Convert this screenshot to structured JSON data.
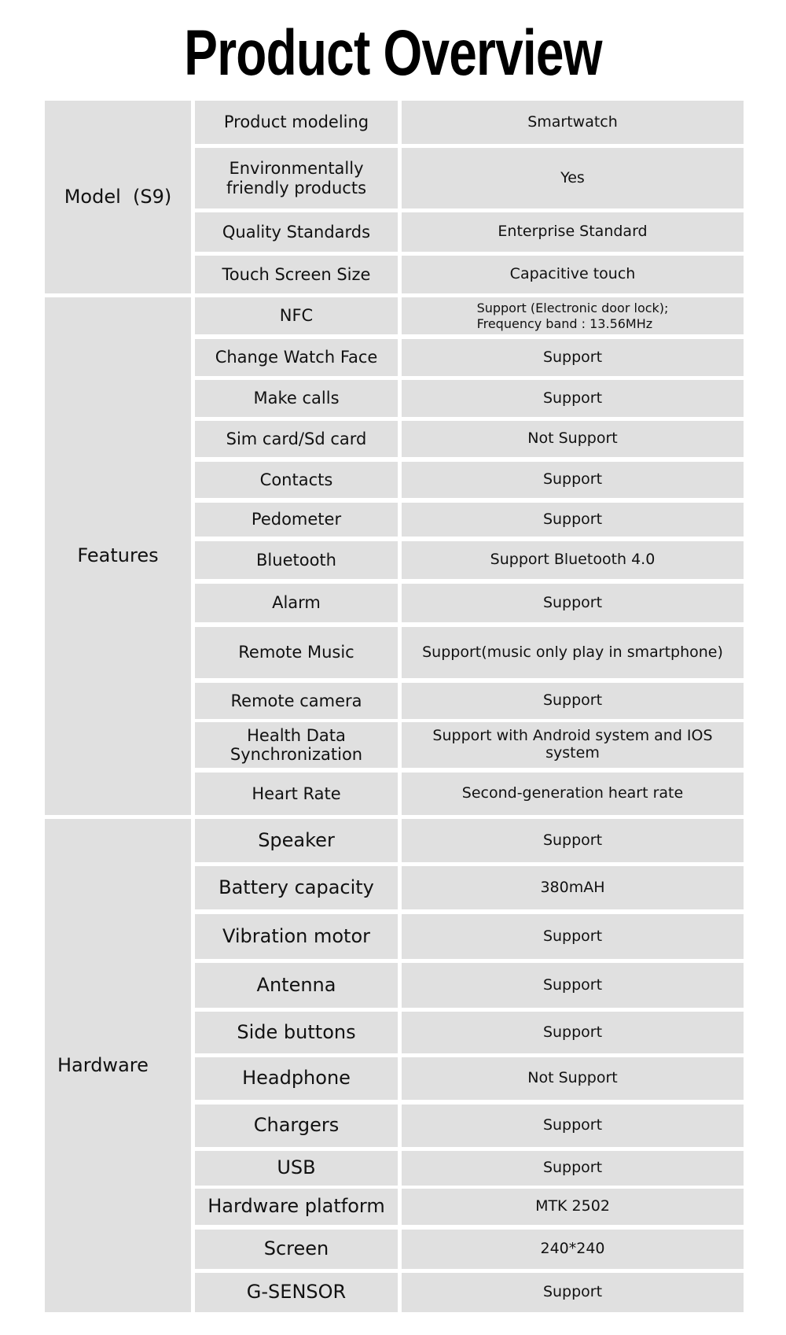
{
  "title": "Product Overview",
  "sections": [
    {
      "group": "Model  (S9)",
      "rows": [
        {
          "label": "Product modeling",
          "value": "Smartwatch"
        },
        {
          "label": "Environmentally friendly products",
          "value": "Yes"
        },
        {
          "label": "Quality Standards",
          "value": "Enterprise Standard"
        },
        {
          "label": "Touch Screen Size",
          "value": "Capacitive touch"
        }
      ]
    },
    {
      "group": "Features",
      "rows": [
        {
          "label": "NFC",
          "value": "Support (Electronic door lock);\nFrequency band : 13.56MHz"
        },
        {
          "label": "Change Watch Face",
          "value": "Support"
        },
        {
          "label": "Make calls",
          "value": "Support"
        },
        {
          "label": "Sim card/Sd card",
          "value": "Not Support"
        },
        {
          "label": "Contacts",
          "value": "Support"
        },
        {
          "label": "Pedometer",
          "value": "Support"
        },
        {
          "label": "Bluetooth",
          "value": "Support Bluetooth 4.0"
        },
        {
          "label": "Alarm",
          "value": "Support"
        },
        {
          "label": "Remote Music",
          "value": "Support(music only play in smartphone)"
        },
        {
          "label": "Remote camera",
          "value": "Support"
        },
        {
          "label": "Health Data Synchronization",
          "value": "Support with Android system and IOS system"
        },
        {
          "label": "Heart Rate",
          "value": "Second-generation heart rate"
        }
      ]
    },
    {
      "group": "Hardware",
      "rows": [
        {
          "label": "Speaker",
          "value": "Support"
        },
        {
          "label": "Battery capacity",
          "value": "380mAH"
        },
        {
          "label": "Vibration motor",
          "value": "Support"
        },
        {
          "label": "Antenna",
          "value": "Support"
        },
        {
          "label": "Side buttons",
          "value": "Support"
        },
        {
          "label": "Headphone",
          "value": "Not Support"
        },
        {
          "label": "Chargers",
          "value": "Support"
        },
        {
          "label": "USB",
          "value": "Support"
        },
        {
          "label": "Hardware platform",
          "value": "MTK 2502"
        },
        {
          "label": "Screen",
          "value": "240*240"
        },
        {
          "label": "G-SENSOR",
          "value": "Support"
        }
      ]
    }
  ]
}
